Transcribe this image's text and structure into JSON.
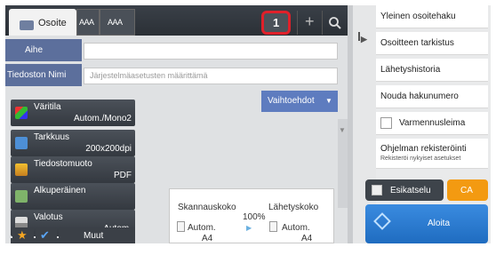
{
  "tabs": {
    "active_label": "Osoite",
    "cap1": "AAA",
    "cap2": "AAA",
    "one_touch": "1"
  },
  "fields": {
    "subject_label": "Aihe",
    "subject_value": "",
    "filename_label": "Tiedoston Nimi",
    "filename_placeholder": "Järjestelmäasetusten määrittämä"
  },
  "options_label": "Vaihtoehdot",
  "settings": [
    {
      "name": "Väritila",
      "value": "Autom./Mono2"
    },
    {
      "name": "Tarkkuus",
      "value": "200x200dpi"
    },
    {
      "name": "Tiedostomuoto",
      "value": "PDF"
    },
    {
      "name": "Alkuperäinen",
      "value": ""
    },
    {
      "name": "Valotus",
      "value": "Autom."
    }
  ],
  "bottom": {
    "more_label": "Muut"
  },
  "scan_panel": {
    "scan_size_label": "Skannauskoko",
    "send_size_label": "Lähetyskoko",
    "ratio": "100%",
    "scan_mode": "Autom.",
    "scan_paper": "A4",
    "send_mode": "Autom.",
    "send_paper": "A4"
  },
  "right_menu": [
    "Yleinen osoitehaku",
    "Osoitteen tarkistus",
    "Lähetyshistoria",
    "Nouda hakunumero",
    "Varmennusleima"
  ],
  "program": {
    "title": "Ohjelman rekisteröinti",
    "subtitle": "Rekisteröi nykyiset asetukset"
  },
  "actions": {
    "preview": "Esikatselu",
    "ca": "CA",
    "start": "Aloita"
  },
  "colors": {
    "accent_green": "#39b54a",
    "ca_orange": "#f39a11",
    "start_blue": "#2c7fd6",
    "highlight_red": "#e0202a"
  }
}
